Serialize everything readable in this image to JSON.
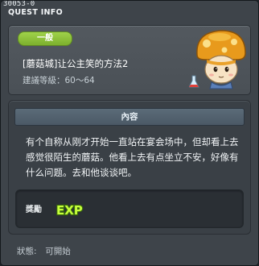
{
  "window": {
    "quest_code": "30053-0",
    "title": "QUEST INFO"
  },
  "quest": {
    "category": "一般",
    "name": "[蘑菇城]让公主笑的方法2",
    "level_text": "建議等級：60～64",
    "npc_icon": "mushroom-npc-portrait"
  },
  "content": {
    "header": "內容",
    "description": "有个自称从刚才开始一直站在宴会场中，但却看上去感觉很陌生的蘑菇。他看上去有点坐立不安，好像有什么问题。去和他谈谈吧。"
  },
  "reward": {
    "label": "獎勵",
    "exp_text": "EXP"
  },
  "status": {
    "label": "狀態:",
    "value": "可開始"
  },
  "colors": {
    "badge_green": "#8cc63f",
    "panel_bg": "#3e444a",
    "exp_green": "#b7f23a"
  }
}
